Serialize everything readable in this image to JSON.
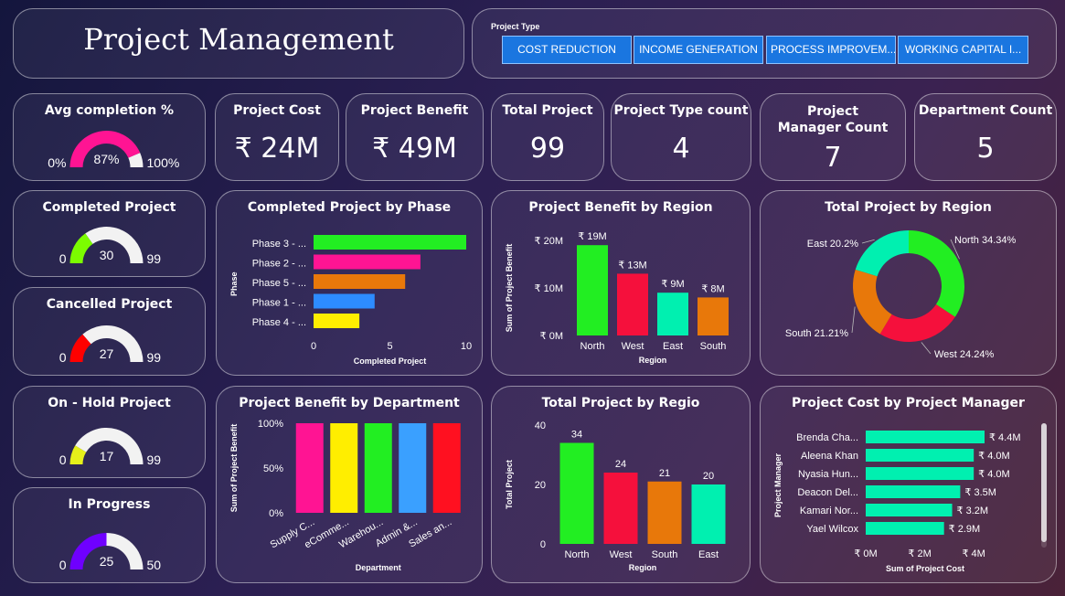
{
  "header": {
    "title": "Project Management"
  },
  "slicer": {
    "label": "Project Type",
    "options": [
      "COST REDUCTION",
      "INCOME GENERATION",
      "PROCESS IMPROVEM...",
      "WORKING CAPITAL I..."
    ]
  },
  "gauges": {
    "avg_completion": {
      "title": "Avg completion %",
      "min": "0%",
      "max": "100%",
      "value": "87%",
      "fraction": 0.87,
      "color": "#ff1493"
    },
    "completed": {
      "title": "Completed Project",
      "min": "0",
      "max": "99",
      "value": "30",
      "fraction": 0.303,
      "color": "#7cfc00"
    },
    "cancelled": {
      "title": "Cancelled Project",
      "min": "0",
      "max": "99",
      "value": "27",
      "fraction": 0.273,
      "color": "#ff0000"
    },
    "on_hold": {
      "title": "On - Hold Project",
      "min": "0",
      "max": "99",
      "value": "17",
      "fraction": 0.172,
      "color": "#e6f01a"
    },
    "in_progress": {
      "title": "In Progress",
      "min": "0",
      "max": "50",
      "value": "25",
      "fraction": 0.5,
      "color": "#6f00ff"
    }
  },
  "kpis": {
    "cost": {
      "title": "Project Cost",
      "value": "₹ 24M"
    },
    "benefit": {
      "title": "Project Benefit",
      "value": "₹ 49M"
    },
    "total": {
      "title": "Total Project",
      "value": "99"
    },
    "type_count": {
      "title": "Project Type count",
      "value": "4"
    },
    "manager_count": {
      "title": "Project Manager Count",
      "value": "7"
    },
    "dept_count": {
      "title": "Department Count",
      "value": "5"
    }
  },
  "chart_data": [
    {
      "id": "phase",
      "type": "bar",
      "orientation": "horizontal",
      "title": "Completed Project by Phase",
      "xlabel": "Completed Project",
      "ylabel": "Phase",
      "categories": [
        "Phase 3 - ...",
        "Phase 2 - ...",
        "Phase 5 - ...",
        "Phase 1 - ...",
        "Phase 4 - ..."
      ],
      "values": [
        10,
        7,
        6,
        4,
        3
      ],
      "colors": [
        "#22ee22",
        "#ff1493",
        "#e8780a",
        "#2d8cff",
        "#ffee00"
      ],
      "ticks": [
        "0",
        "5",
        "10"
      ],
      "xlim": [
        0,
        10
      ]
    },
    {
      "id": "benefit_region",
      "type": "bar",
      "title": "Project Benefit by Region",
      "xlabel": "Region",
      "ylabel": "Sum of Project Benefit",
      "categories": [
        "North",
        "West",
        "East",
        "South"
      ],
      "values": [
        19,
        13,
        9,
        8
      ],
      "data_labels": [
        "₹ 19M",
        "₹ 13M",
        "₹ 9M",
        "₹ 8M"
      ],
      "colors": [
        "#22ee22",
        "#f5103c",
        "#00f0b0",
        "#e8780a"
      ],
      "ticks": [
        "₹ 0M",
        "₹ 10M",
        "₹ 20M"
      ],
      "ylim": [
        0,
        20
      ]
    },
    {
      "id": "total_region_donut",
      "type": "pie",
      "title": "Total Project by Region",
      "categories": [
        "North",
        "West",
        "South",
        "East"
      ],
      "values": [
        34.34,
        24.24,
        21.21,
        20.2
      ],
      "data_labels": [
        "North 34.34%",
        "West 24.24%",
        "South 21.21%",
        "East 20.2%"
      ],
      "colors": [
        "#22ee22",
        "#f5103c",
        "#e8780a",
        "#00f0b0"
      ]
    },
    {
      "id": "benefit_dept",
      "type": "bar",
      "title": "Project Benefit by Department",
      "xlabel": "Department",
      "ylabel": "Sum of Project Benefit",
      "categories": [
        "Supply C...",
        "eComme...",
        "Warehou...",
        "Admin &...",
        "Sales an..."
      ],
      "values": [
        100,
        100,
        100,
        100,
        100
      ],
      "colors": [
        "#ff1493",
        "#ffee00",
        "#22ee22",
        "#3aa0ff",
        "#ff1020"
      ],
      "ticks": [
        "0%",
        "50%",
        "100%"
      ],
      "ylim": [
        0,
        100
      ]
    },
    {
      "id": "total_regio",
      "type": "bar",
      "title": "Total Project by Regio",
      "xlabel": "Region",
      "ylabel": "Total Project",
      "categories": [
        "North",
        "West",
        "South",
        "East"
      ],
      "values": [
        34,
        24,
        21,
        20
      ],
      "data_labels": [
        "34",
        "24",
        "21",
        "20"
      ],
      "colors": [
        "#22ee22",
        "#f5103c",
        "#e8780a",
        "#00f0b0"
      ],
      "ticks": [
        "0",
        "20",
        "40"
      ],
      "ylim": [
        0,
        40
      ]
    },
    {
      "id": "cost_manager",
      "type": "bar",
      "orientation": "horizontal",
      "title": "Project Cost by Project Manager",
      "xlabel": "Sum of Project Cost",
      "ylabel": "Project Manager",
      "categories": [
        "Brenda Cha...",
        "Aleena Khan",
        "Nyasia Hun...",
        "Deacon Del...",
        "Kamari Nor...",
        "Yael Wilcox"
      ],
      "values": [
        4.4,
        4.0,
        4.0,
        3.5,
        3.2,
        2.9
      ],
      "data_labels": [
        "₹ 4.4M",
        "₹ 4.0M",
        "₹ 4.0M",
        "₹ 3.5M",
        "₹ 3.2M",
        "₹ 2.9M"
      ],
      "colors": [
        "#00f0b0",
        "#00f0b0",
        "#00f0b0",
        "#00f0b0",
        "#00f0b0",
        "#00f0b0"
      ],
      "ticks": [
        "₹ 0M",
        "₹ 2M",
        "₹ 4M"
      ],
      "xlim": [
        0,
        4.4
      ]
    }
  ]
}
